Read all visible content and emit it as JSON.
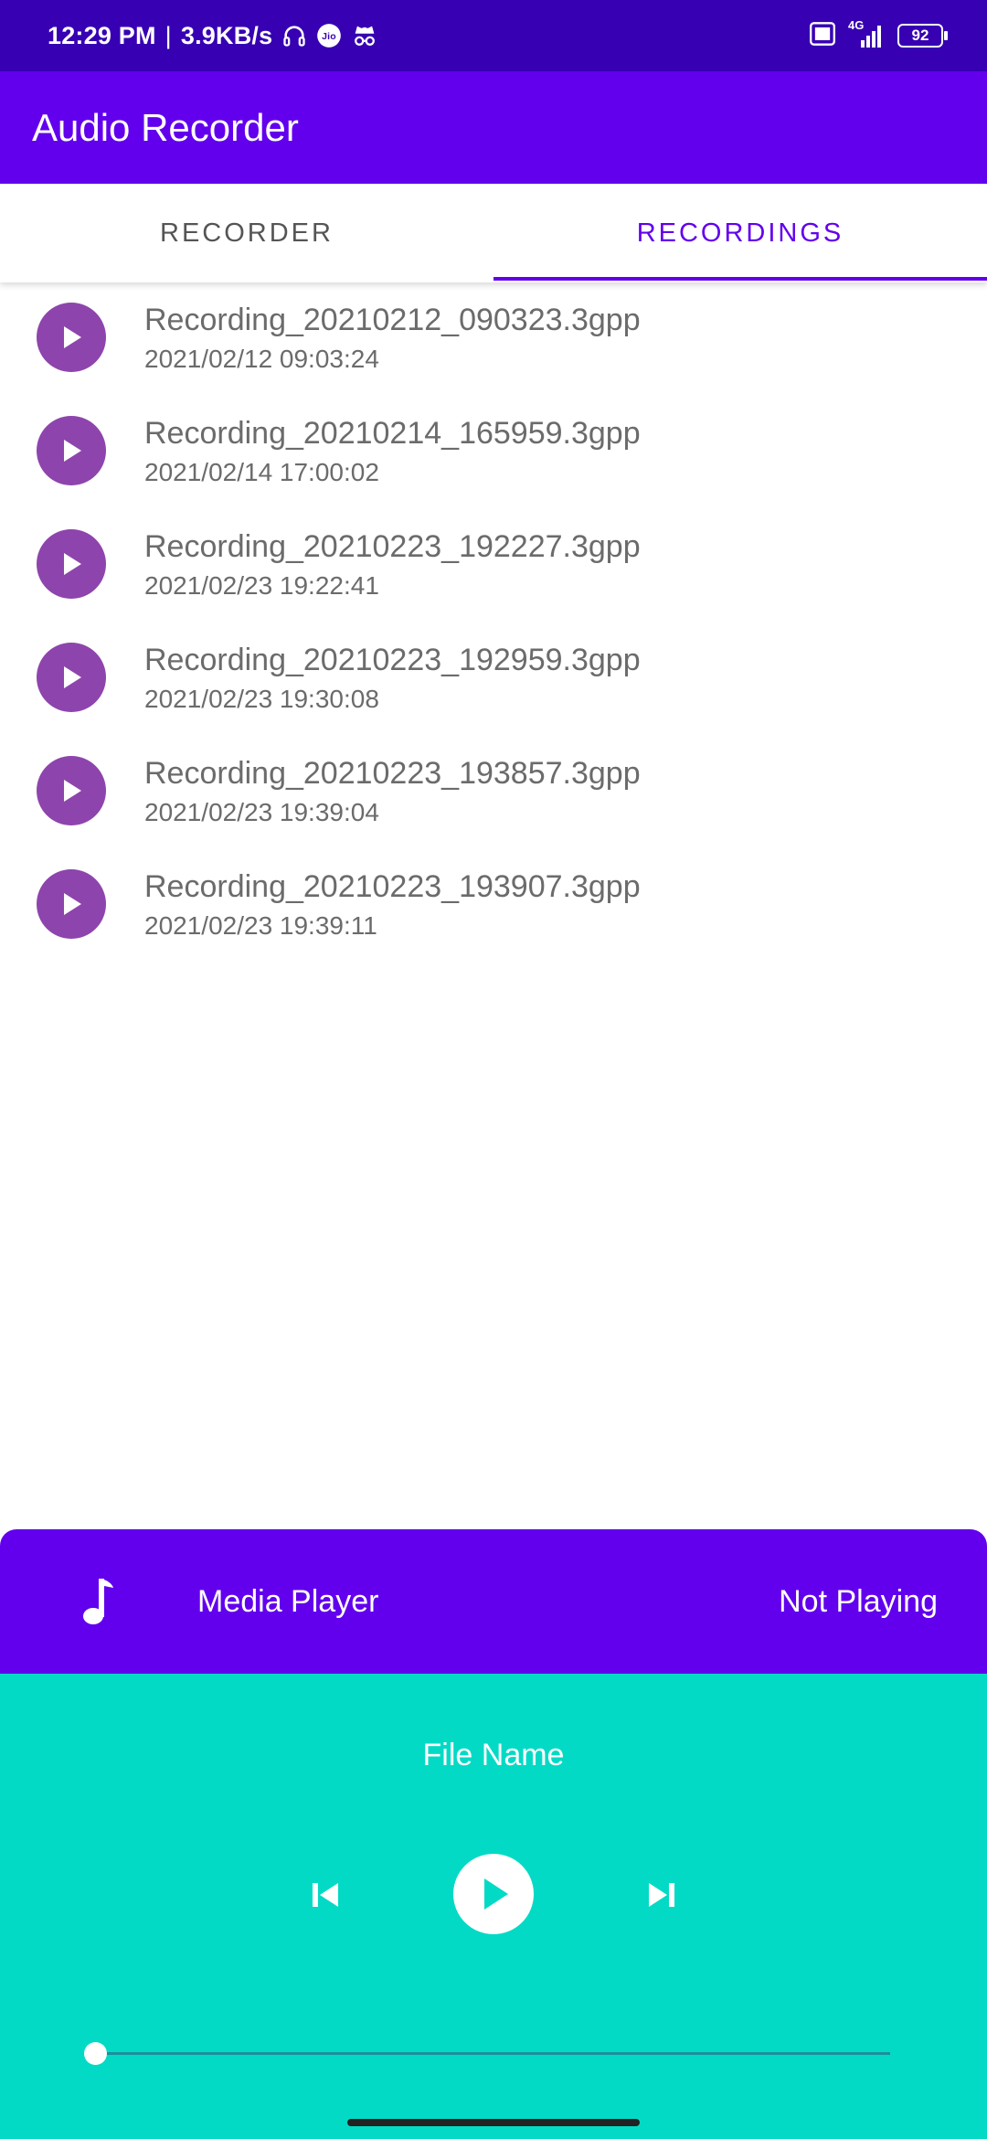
{
  "status_bar": {
    "time": "12:29 PM",
    "separator": "|",
    "speed": "3.9KB/s",
    "jio_label": "Jio",
    "network": "4G",
    "battery": "92"
  },
  "app": {
    "title": "Audio Recorder"
  },
  "tabs": [
    {
      "label": "RECORDER",
      "active": false
    },
    {
      "label": "RECORDINGS",
      "active": true
    }
  ],
  "recordings": [
    {
      "name": "Recording_20210212_090323.3gpp",
      "date": "2021/02/12 09:03:24"
    },
    {
      "name": "Recording_20210214_165959.3gpp",
      "date": "2021/02/14 17:00:02"
    },
    {
      "name": "Recording_20210223_192227.3gpp",
      "date": "2021/02/23 19:22:41"
    },
    {
      "name": "Recording_20210223_192959.3gpp",
      "date": "2021/02/23 19:30:08"
    },
    {
      "name": "Recording_20210223_193857.3gpp",
      "date": "2021/02/23 19:39:04"
    },
    {
      "name": "Recording_20210223_193907.3gpp",
      "date": "2021/02/23 19:39:11"
    }
  ],
  "player": {
    "title": "Media Player",
    "state": "Not Playing",
    "file_name": "File Name",
    "progress": 0
  },
  "colors": {
    "status_bar": "#3700b3",
    "primary": "#6200ee",
    "play_button": "#8e44ad",
    "player_body": "#03dac5"
  }
}
